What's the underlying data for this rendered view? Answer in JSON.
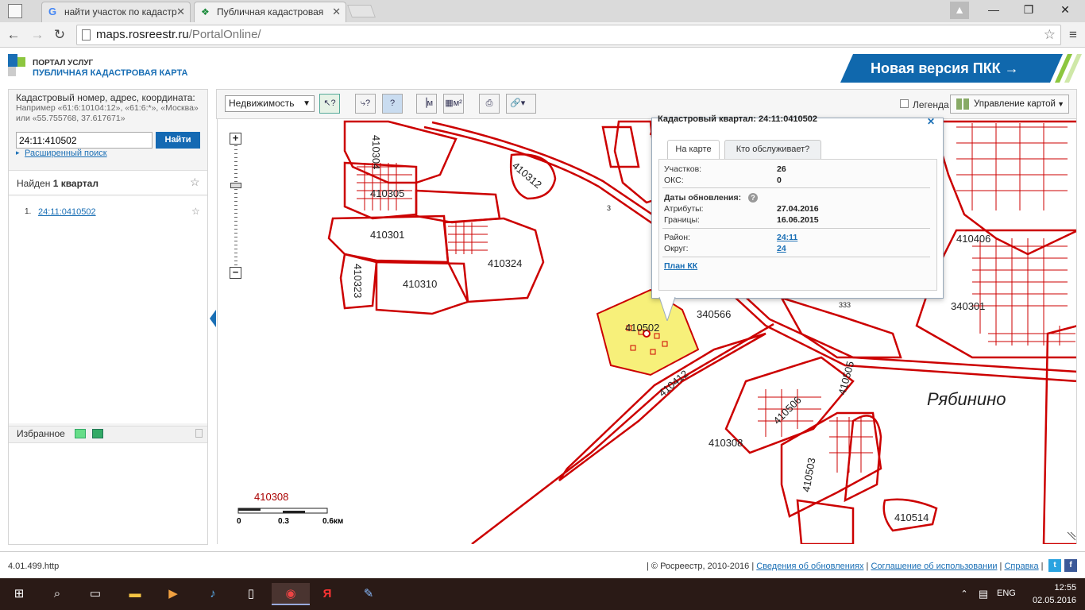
{
  "browser": {
    "tabs": [
      {
        "label": "найти участок по кадастр"
      },
      {
        "label": "Публичная кадастровая"
      }
    ],
    "address_host": "maps.rosreestr.ru",
    "address_path": "/PortalOnline/"
  },
  "header": {
    "logo_line1": "ПОРТАЛ УСЛУГ",
    "logo_line2": "ПУБЛИЧНАЯ КАДАСТРОВАЯ КАРТА",
    "new_version": "Новая версия ПКК →"
  },
  "search": {
    "label": "Кадастровый номер, адрес, координата:",
    "hint": "Например «61:6:10104:12», «61:6:*», «Москва» или «55.755768, 37.617671»",
    "value": "24:11:410502",
    "button": "Найти",
    "advanced": "Расширенный поиск"
  },
  "results": {
    "found_prefix": "Найден ",
    "found_count": "1 квартал",
    "items": [
      {
        "num": "1.",
        "label": "24:11:0410502"
      }
    ]
  },
  "favorites": {
    "label": "Избранное"
  },
  "map_toolbar": {
    "layer": "Недвижимость",
    "legend": "Легенда",
    "manage": "Управление картой"
  },
  "map": {
    "labels": [
      "410304",
      "410305",
      "410301",
      "410312",
      "410323",
      "410310",
      "410324",
      "410502",
      "340566",
      "410412",
      "410505",
      "410506",
      "410308",
      "410503",
      "410514",
      "410406",
      "340301",
      "410308",
      "3",
      "333"
    ],
    "place": "Рябинино",
    "scale": [
      "0",
      "0.3",
      "0.6км"
    ]
  },
  "popup": {
    "title": "Кадастровый квартал: 24:11:0410502",
    "tab_map": "На карте",
    "tab_service": "Кто обслуживает?",
    "rows": {
      "parcels_label": "Участков:",
      "parcels": "26",
      "oks_label": "ОКС:",
      "oks": "0",
      "dates_label": "Даты обновления:",
      "attrs_label": "Атрибуты:",
      "attrs": "27.04.2016",
      "bounds_label": "Границы:",
      "bounds": "16.06.2015",
      "district_label": "Район:",
      "district": "24:11",
      "okrug_label": "Округ:",
      "okrug": "24"
    },
    "plan": "План КК"
  },
  "footer": {
    "version": "4.01.499.http",
    "copyright": "| © Росреестр, 2010-2016 |",
    "link_updates": "Сведения об обновлениях",
    "link_terms": "Соглашение об использовании",
    "link_help": "Справка"
  },
  "taskbar": {
    "lang": "ENG",
    "time": "12:55",
    "date": "02.05.2016"
  },
  "colors": {
    "accent": "#1469b3",
    "parcel": "#cc0000",
    "highlight": "#f7f07a"
  }
}
